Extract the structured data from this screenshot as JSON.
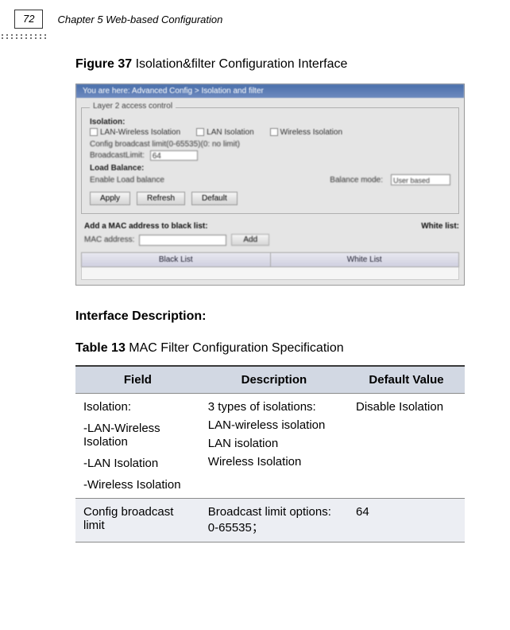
{
  "header": {
    "page_number": "72",
    "chapter_title": "Chapter 5 Web-based Configuration"
  },
  "figure": {
    "caption_label": "Figure 37",
    "caption_text": " Isolation&filter Configuration Interface"
  },
  "panel": {
    "breadcrumb": "You are here: Advanced Config > Isolation and filter",
    "layer_legend": "Layer 2 access control",
    "isolation_label": "Isolation:",
    "iso_opt1": "LAN-Wireless Isolation",
    "iso_opt2": "LAN Isolation",
    "iso_opt3": "Wireless Isolation",
    "config_broadcast": "Config broadcast limit(0-65535)(0: no limit)",
    "broadcast_limit_label": "BroadcastLimit:",
    "broadcast_limit_value": "64",
    "load_balance_label": "Load Balance:",
    "enable_lb": "Enable Load balance",
    "balance_mode": "Balance mode:",
    "balance_mode_value": "User based",
    "btn_apply": "Apply",
    "btn_refresh": "Refresh",
    "btn_default": "Default",
    "add_mac_label": "Add a MAC address to black list:",
    "white_list_label": "White list:",
    "mac_address_label": "MAC address:",
    "btn_add": "Add",
    "black_list_header": "Black List",
    "white_list_header": "White List"
  },
  "interface_description": "Interface Description:",
  "table": {
    "caption_label": "Table 13",
    "caption_text": "  MAC Filter Configuration Specification",
    "headers": {
      "field": "Field",
      "description": "Description",
      "default": "Default Value"
    },
    "row1": {
      "field_1": "Isolation:",
      "field_2": "-LAN-Wireless Isolation",
      "field_3": "-LAN Isolation",
      "field_4": "-Wireless Isolation",
      "desc_1": "3 types of isolations:",
      "desc_2": "LAN-wireless isolation",
      "desc_3": "LAN isolation",
      "desc_4": "Wireless Isolation",
      "default": "Disable Isolation"
    },
    "row2": {
      "field": "Config broadcast limit",
      "desc": "Broadcast limit options: 0-65535；",
      "default": "64"
    }
  }
}
